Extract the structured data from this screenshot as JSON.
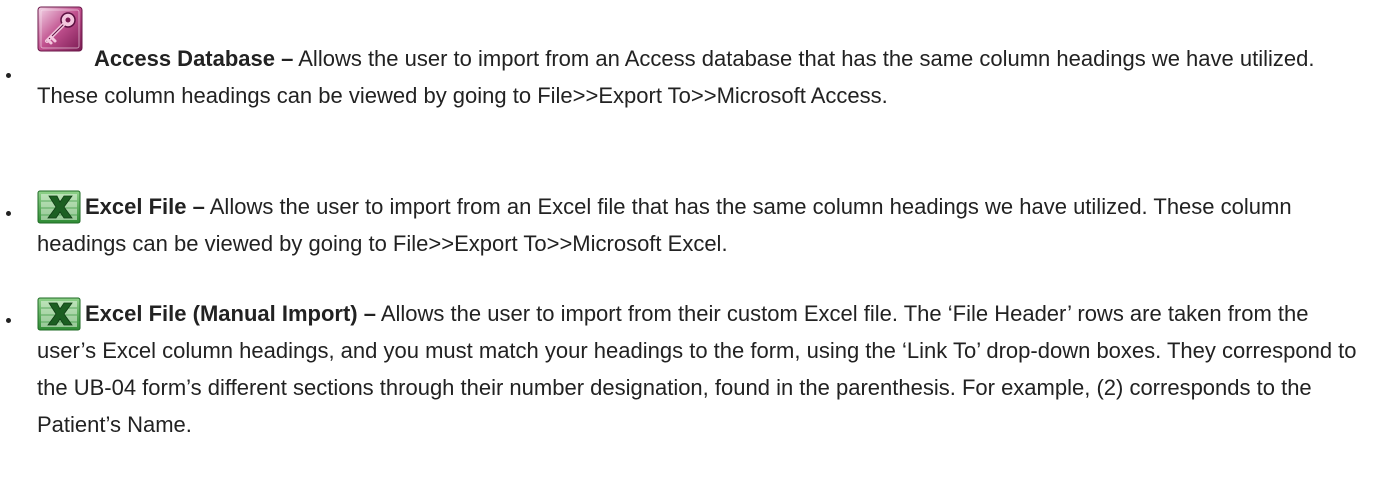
{
  "items": [
    {
      "icon": "access-key-icon",
      "term": "Access Database –",
      "text": " Allows the user to import from an Access database that has the same column headings we have utilized. These column headings can be viewed by going to File>>Export To>>Microsoft Access."
    },
    {
      "icon": "excel-icon",
      "term": "Excel File –",
      "text": " Allows the user to import from an Excel file that has the same column headings we have utilized. These column headings can be viewed by going to File>>Export To>>Microsoft Excel."
    },
    {
      "icon": "excel-icon",
      "term": "Excel File (Manual Import) –",
      "text": " Allows the user to import from their custom Excel file. The ‘File Header’ rows are taken from the user’s Excel column headings, and you must match your headings to the form, using the ‘Link To’ drop-down boxes. They correspond to the UB-04 form’s different sections through their number designation, found in the parenthesis. For example, (2) corresponds to the Patient’s Name."
    }
  ],
  "colors": {
    "text": "#222222",
    "access_purple": "#9b2a6e",
    "excel_green": "#2e8b34"
  }
}
